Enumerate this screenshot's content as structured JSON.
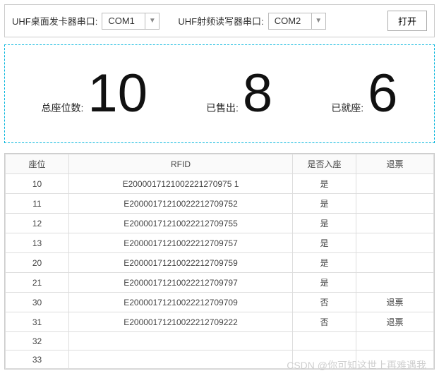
{
  "toolbar": {
    "port1_label": "UHF桌面发卡器串口:",
    "port1_value": "COM1",
    "port2_label": "UHF射频读写器串口:",
    "port2_value": "COM2",
    "open_label": "打开"
  },
  "stats": {
    "total_label": "总座位数:",
    "total_value": "10",
    "sold_label": "已售出:",
    "sold_value": "8",
    "seated_label": "已就座:",
    "seated_value": "6"
  },
  "table": {
    "headers": {
      "seat": "座位",
      "rfid": "RFID",
      "seated": "是否入座",
      "refund": "退票"
    },
    "rows": [
      {
        "seat": "10",
        "rfid": "E2000017121002221270975 1",
        "seated": "是",
        "refund": ""
      },
      {
        "seat": "11",
        "rfid": "E20000171210022212709752",
        "seated": "是",
        "refund": ""
      },
      {
        "seat": "12",
        "rfid": "E20000171210022212709755",
        "seated": "是",
        "refund": ""
      },
      {
        "seat": "13",
        "rfid": "E20000171210022212709757",
        "seated": "是",
        "refund": ""
      },
      {
        "seat": "20",
        "rfid": "E20000171210022212709759",
        "seated": "是",
        "refund": ""
      },
      {
        "seat": "21",
        "rfid": "E20000171210022212709797",
        "seated": "是",
        "refund": ""
      },
      {
        "seat": "30",
        "rfid": "E20000171210022212709709",
        "seated": "否",
        "refund": "退票"
      },
      {
        "seat": "31",
        "rfid": "E20000171210022212709222",
        "seated": "否",
        "refund": "退票"
      },
      {
        "seat": "32",
        "rfid": "",
        "seated": "",
        "refund": ""
      },
      {
        "seat": "33",
        "rfid": "",
        "seated": "",
        "refund": ""
      }
    ]
  },
  "watermark": "CSDN @你可知这世上再难遇我"
}
